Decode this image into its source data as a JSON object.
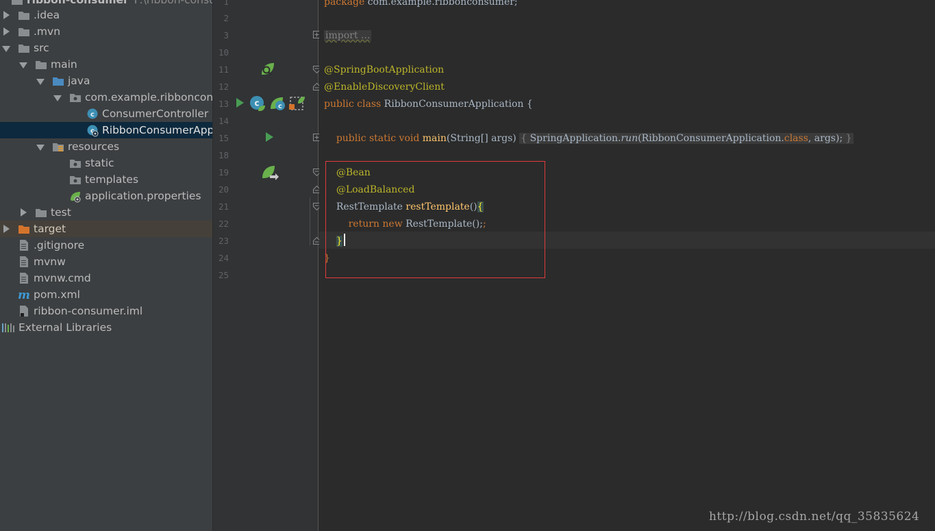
{
  "project_tree": {
    "rows": [
      {
        "label": "ribbon-consumer",
        "suffix": "F:\\ribbon-consumer",
        "icon": "module-folder-icon"
      },
      {
        "label": ".idea",
        "icon": "folder-icon"
      },
      {
        "label": ".mvn",
        "icon": "folder-icon"
      },
      {
        "label": "src",
        "icon": "folder-icon"
      },
      {
        "label": "main",
        "icon": "folder-icon"
      },
      {
        "label": "java",
        "icon": "source-folder-icon"
      },
      {
        "label": "com.example.ribbonconsumer",
        "icon": "package-icon"
      },
      {
        "label": "ConsumerController",
        "icon": "class-icon"
      },
      {
        "label": "RibbonConsumerApplication",
        "icon": "spring-boot-class-icon"
      },
      {
        "label": "resources",
        "icon": "resources-folder-icon"
      },
      {
        "label": "static",
        "icon": "folder-icon"
      },
      {
        "label": "templates",
        "icon": "folder-icon"
      },
      {
        "label": "application.properties",
        "icon": "spring-properties-icon"
      },
      {
        "label": "test",
        "icon": "folder-icon"
      },
      {
        "label": "target",
        "icon": "excluded-folder-icon"
      },
      {
        "label": ".gitignore",
        "icon": "text-file-icon"
      },
      {
        "label": "mvnw",
        "icon": "text-file-icon"
      },
      {
        "label": "mvnw.cmd",
        "icon": "text-file-icon"
      },
      {
        "label": "pom.xml",
        "icon": "maven-icon"
      },
      {
        "label": "ribbon-consumer.iml",
        "icon": "iml-file-icon"
      },
      {
        "label": "External Libraries",
        "icon": "libraries-icon"
      }
    ]
  },
  "editor": {
    "line_numbers": [
      "1",
      "2",
      "3",
      "10",
      "11",
      "12",
      "13",
      "14",
      "15",
      "18",
      "19",
      "20",
      "21",
      "22",
      "23",
      "24",
      "25"
    ],
    "code": {
      "l1_kw": "package",
      "l1_rest": " com.example.ribbonconsumer;",
      "l3_import": "import ...",
      "l11_ann": "@SpringBootApplication",
      "l12_ann": "@EnableDiscoveryClient",
      "l13_kw": "public class",
      "l13_rest": " RibbonConsumerApplication {",
      "l15_kw": "public static void",
      "l15_fn": "main",
      "l15_params": "(String[] args)",
      "l15_chip_open": "{",
      "l15_call_a": "SpringApplication.",
      "l15_call_run": "run",
      "l15_call_b": "(RibbonConsumerApplication.",
      "l15_call_class": "class",
      "l15_call_c": ", args);",
      "l15_chip_close": "}",
      "l19_ann": "@Bean",
      "l20_ann": "@LoadBalanced",
      "l21_type": "RestTemplate ",
      "l21_fn": "restTemplate",
      "l21_parens": "()",
      "l21_brace": "{",
      "l22_kw": "return new",
      "l22_rest": " RestTemplate();",
      "l23_brace": "}",
      "l24_brace": "}"
    }
  },
  "watermark": "http://blog.csdn.net/qq_35835624",
  "colors": {
    "keyword": "#cc7832",
    "annotation": "#bbb529",
    "method": "#ffc66d",
    "text": "#a9b7c6",
    "highlight_box": "#e23b3b"
  }
}
